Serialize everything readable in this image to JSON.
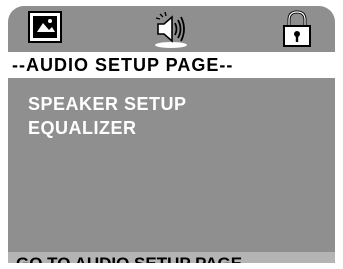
{
  "icon_bar": {
    "icons": [
      "general-setup-icon",
      "audio-setup-icon",
      "lock-icon"
    ]
  },
  "header": {
    "title": "--AUDIO SETUP PAGE--"
  },
  "menu": {
    "items": [
      {
        "label": "SPEAKER SETUP"
      },
      {
        "label": "EQUALIZER"
      }
    ]
  },
  "status": {
    "text": "GO TO AUDIO SETUP PAGE"
  },
  "colors": {
    "panel": "#8f8f8f",
    "header_bg": "#ffffff",
    "status_bg": "#b4b4b4",
    "menu_text": "#ffffff"
  }
}
